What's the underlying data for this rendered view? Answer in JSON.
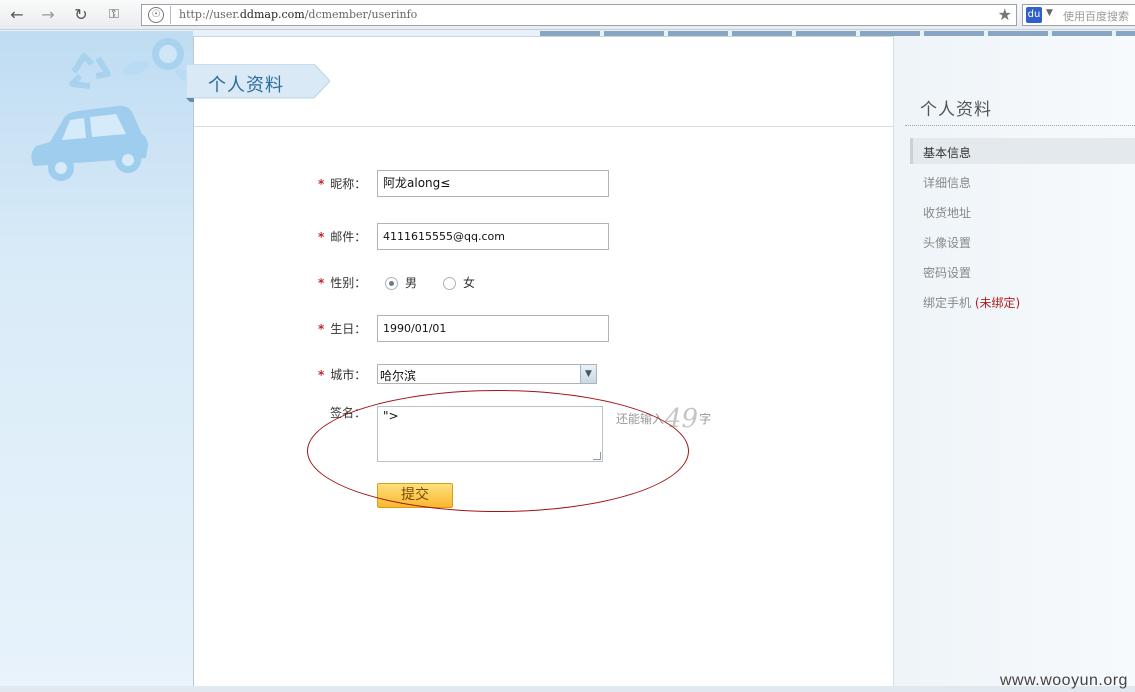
{
  "browser": {
    "url_prefix": "http://user.",
    "url_domain": "ddmap.com",
    "url_path": "/dcmember/userinfo",
    "search_placeholder": "使用百度搜索"
  },
  "page": {
    "title": "个人资料"
  },
  "form": {
    "nickname_label": "昵称：",
    "nickname_value": "阿龙along≤",
    "email_label": "邮件：",
    "email_value": "4111615555@qq.com",
    "gender_label": "性别：",
    "gender_male": "男",
    "gender_female": "女",
    "gender_selected": "男",
    "birthday_label": "生日：",
    "birthday_value": "1990/01/01",
    "city_label": "城市：",
    "city_value": "哈尔滨",
    "signature_label": "签名：",
    "signature_value": "\">",
    "counter_prefix": "还能输入",
    "counter_value": "49",
    "counter_suffix": "字",
    "required_mark": "*",
    "submit_label": "提交"
  },
  "sidebar": {
    "title": "个人资料",
    "items": [
      {
        "label": "基本信息",
        "active": true
      },
      {
        "label": "详细信息"
      },
      {
        "label": "收货地址"
      },
      {
        "label": "头像设置"
      },
      {
        "label": "密码设置"
      },
      {
        "label": "绑定手机"
      }
    ],
    "phone_status": "(未绑定)"
  },
  "watermark": "www.wooyun.org",
  "colors": {
    "accent": "#2d6c9b",
    "required": "#c62626",
    "submit": "#f8b72f",
    "annotation": "#a01414"
  }
}
